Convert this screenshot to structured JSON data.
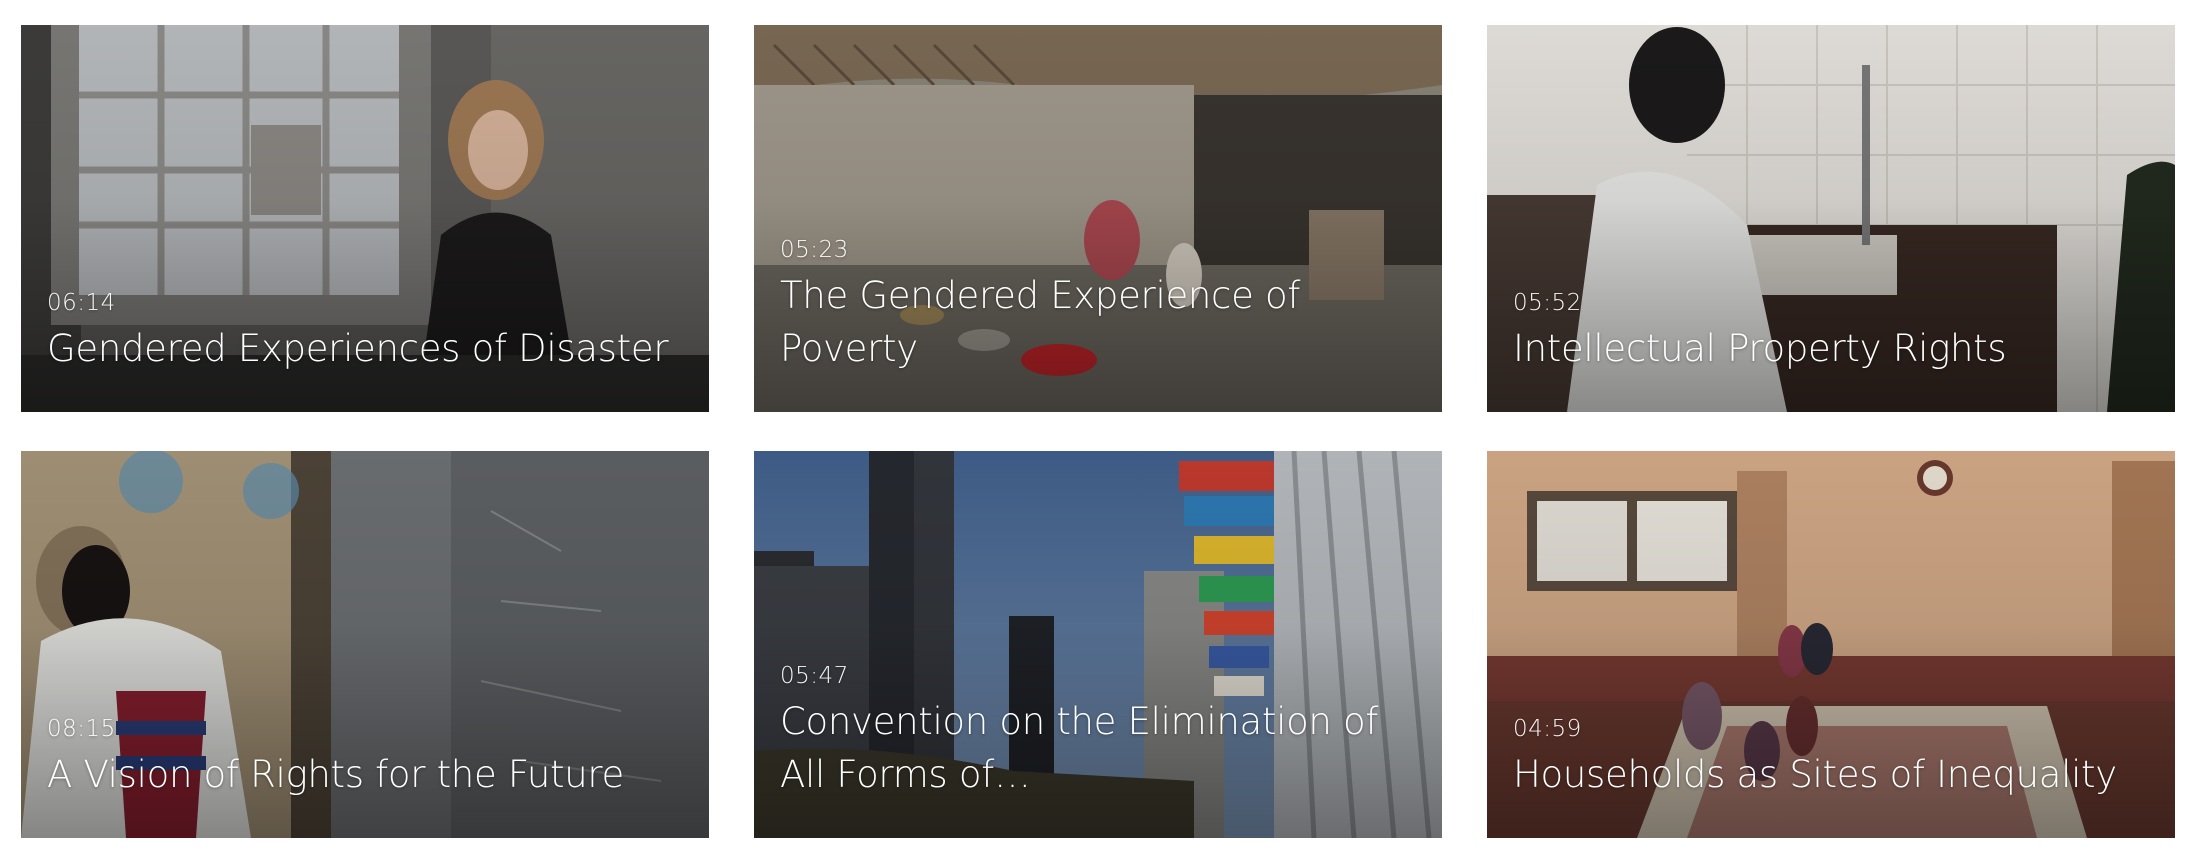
{
  "videos": [
    {
      "duration": "06:14",
      "title": "Gendered Experiences of Disaster",
      "thumbnail": "woman-speaking-by-window"
    },
    {
      "duration": "05:23",
      "title": "The Gendered Experience of Poverty",
      "thumbnail": "woman-cooking-outside-hut"
    },
    {
      "duration": "05:52",
      "title": "Intellectual Property Rights",
      "thumbnail": "health-worker-at-desk"
    },
    {
      "duration": "08:15",
      "title": "A Vision of Rights for the Future",
      "thumbnail": "teacher-at-chalkboard"
    },
    {
      "duration": "05:47",
      "title": "Convention on the Elimination of All Forms of…",
      "thumbnail": "flags-and-skyscrapers"
    },
    {
      "duration": "04:59",
      "title": "Households as Sites of Inequality",
      "thumbnail": "children-in-living-room"
    }
  ]
}
